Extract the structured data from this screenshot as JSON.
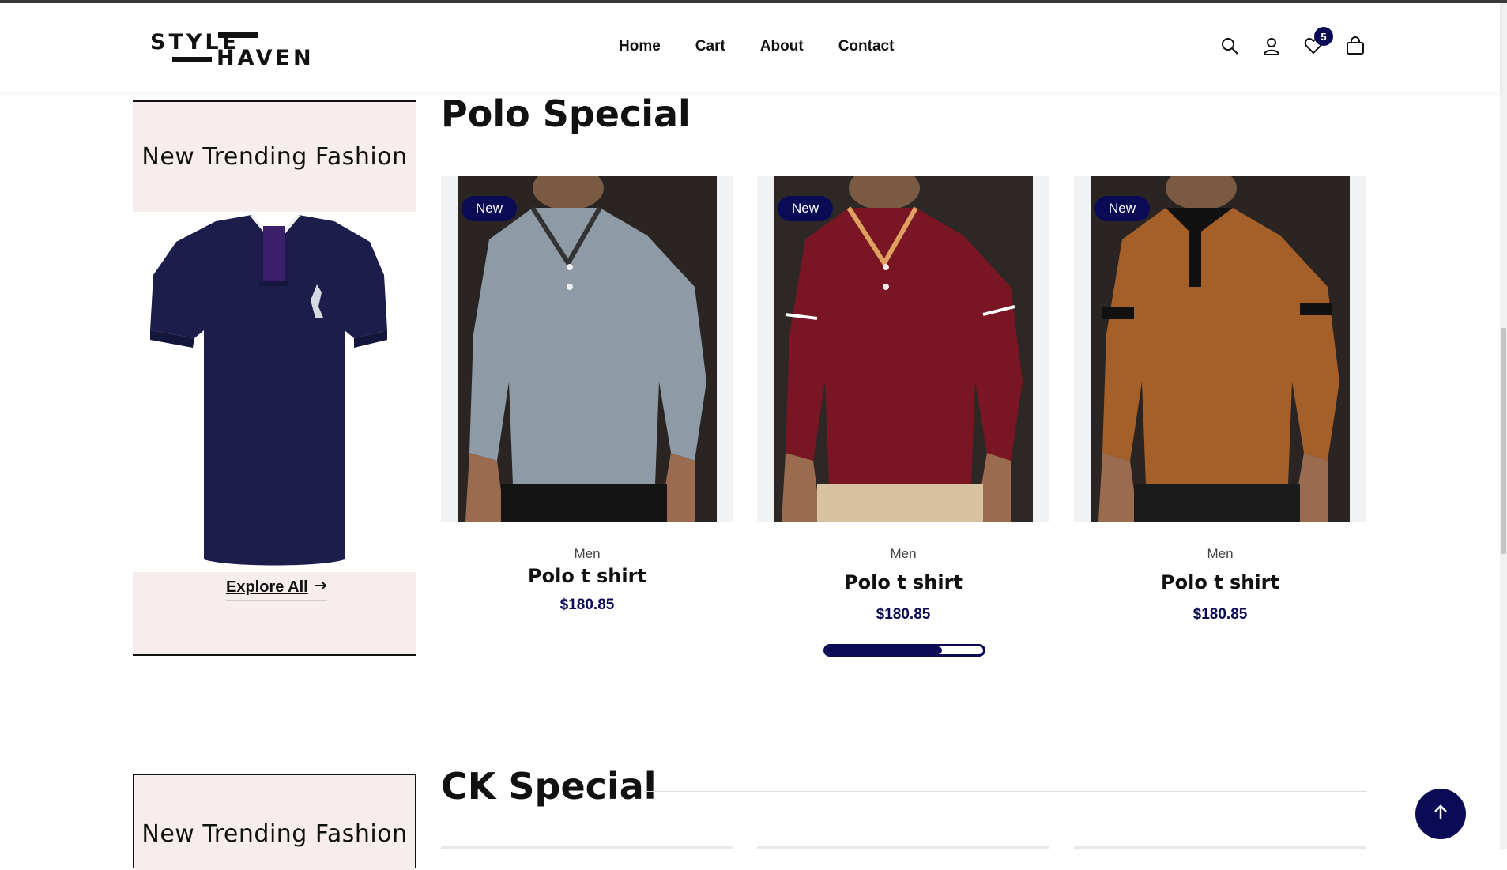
{
  "brand": {
    "line1": "STYLE",
    "line2": "HAVEN"
  },
  "nav": [
    "Home",
    "Cart",
    "About",
    "Contact"
  ],
  "header_icons": {
    "search": "search-icon",
    "account": "user-icon",
    "wishlist": "heart-icon",
    "bag": "shopping-bag-icon",
    "wishlist_count": "5"
  },
  "banner": {
    "title": "New Trending Fashion",
    "explore": "Explore All"
  },
  "sections": [
    {
      "title": "Polo Special"
    },
    {
      "title": "CK Special"
    }
  ],
  "products": [
    {
      "badge": "New",
      "category": "Men",
      "name": "Polo t shirt",
      "price": "$180.85",
      "color": "#8e9aa6"
    },
    {
      "badge": "New",
      "category": "Men",
      "name": "Polo t shirt",
      "price": "$180.85",
      "color": "#7a1524"
    },
    {
      "badge": "New",
      "category": "Men",
      "name": "Polo t shirt",
      "price": "$180.85",
      "color": "#a5602a"
    }
  ],
  "carousel_progress": 0.74,
  "colors": {
    "accent": "#0b0b55",
    "banner_bg": "#f7eded"
  }
}
